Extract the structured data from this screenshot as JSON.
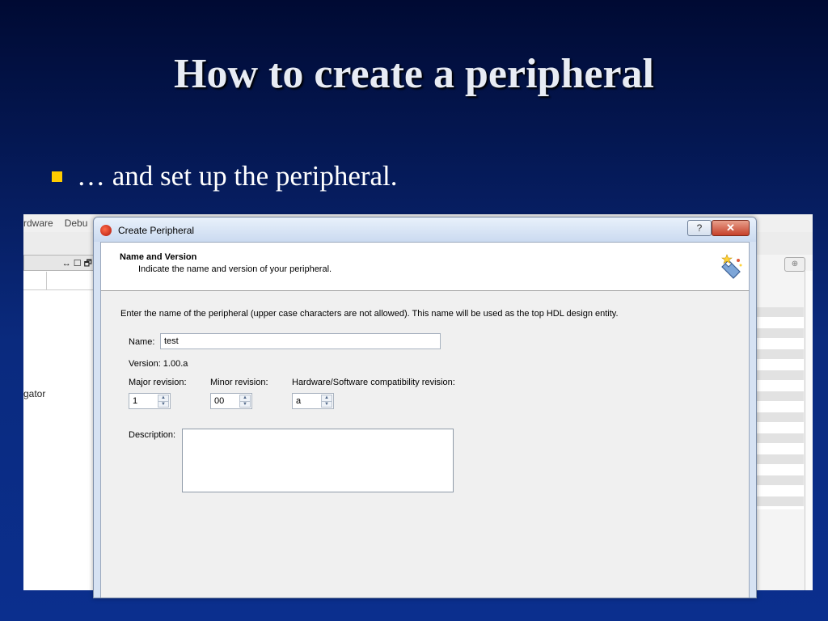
{
  "slide": {
    "title": "How to create a peripheral",
    "bullet": "… and set up the peripheral."
  },
  "ide": {
    "menu": [
      "rdware",
      "Debu"
    ],
    "view_controls": "↔ ☐ 🗗",
    "nav_item": "gator",
    "search_icon": "magnifier-icon"
  },
  "dialog": {
    "title": "Create Peripheral",
    "help_label": "?",
    "close_label": "✕",
    "section_title": "Name and Version",
    "section_subtitle": "Indicate the name and version of your peripheral.",
    "instruction": "Enter the name of the peripheral (upper case characters are not allowed). This name will be used as the top HDL design entity.",
    "name_label": "Name:",
    "name_value": "test",
    "version_text": "Version:  1.00.a",
    "major_label": "Major revision:",
    "major_value": "1",
    "minor_label": "Minor revision:",
    "minor_value": "00",
    "hwsw_label": "Hardware/Software compatibility revision:",
    "hwsw_value": "a",
    "description_label": "Description:",
    "description_value": ""
  },
  "colors": {
    "bullet": "#ffcc00",
    "background_top": "#000a33",
    "background_bottom": "#0b2f8e"
  }
}
